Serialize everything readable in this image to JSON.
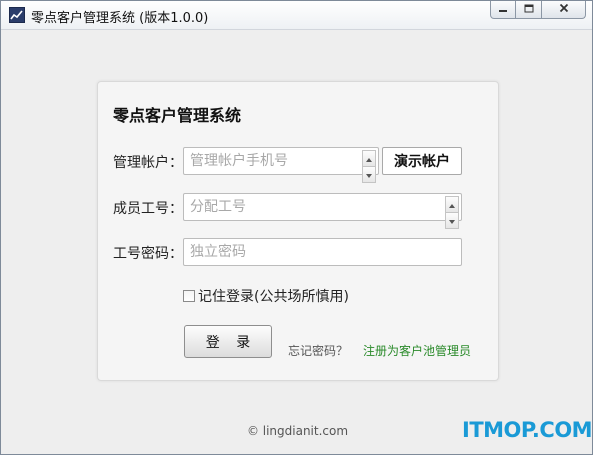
{
  "window": {
    "title": "零点客户管理系统 (版本1.0.0)",
    "icon": "chart-line-icon",
    "controls": [
      "minimize-icon",
      "maximize-icon",
      "close-icon"
    ]
  },
  "login": {
    "heading": "零点客户管理系统",
    "account": {
      "label": "管理帐户：",
      "placeholder": "管理帐户手机号",
      "value": ""
    },
    "demo_button": "演示帐户",
    "member_id": {
      "label": "成员工号：",
      "placeholder": "分配工号",
      "value": ""
    },
    "password": {
      "label": "工号密码：",
      "placeholder": "独立密码",
      "value": ""
    },
    "remember": {
      "label": "记住登录(公共场所慎用)",
      "checked": false
    },
    "login_button": "登 录",
    "forgot_link": "忘记密码？",
    "register_link": "注册为客户池管理员"
  },
  "footer": {
    "copyright": "© lingdianit.com",
    "watermark": "ITMOP.COM"
  },
  "colors": {
    "register_link": "#2a8a2a",
    "watermark": "#1a9ad6"
  }
}
